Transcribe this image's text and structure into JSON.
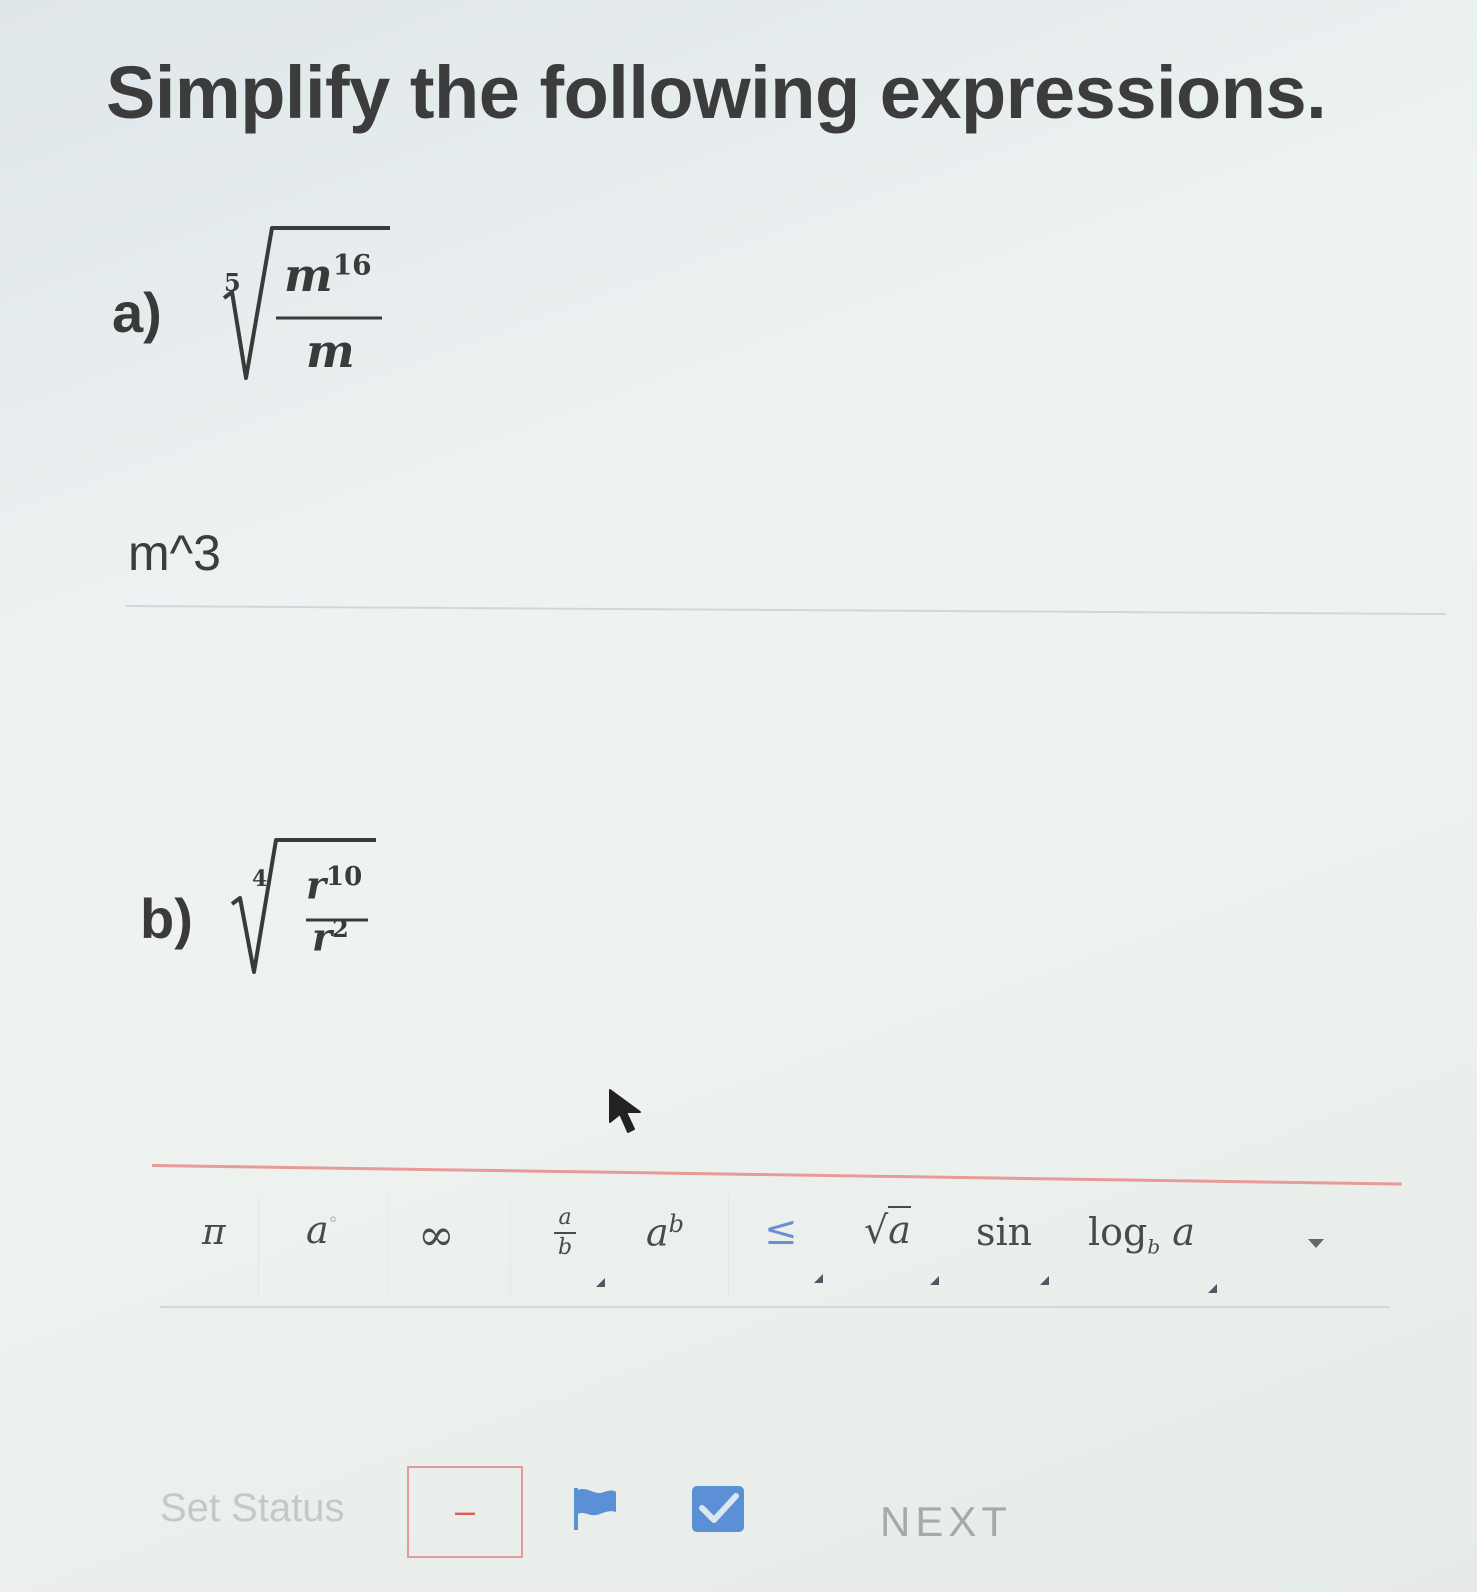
{
  "title": "Simplify the following expressions.",
  "questions": [
    {
      "label": "a)",
      "index": "5",
      "numerator_base": "m",
      "numerator_exp": "16",
      "denominator_base": "m",
      "denominator_exp": "",
      "answer": "m^3"
    },
    {
      "label": "b)",
      "index": "4",
      "numerator_base": "r",
      "numerator_exp": "10",
      "denominator_base": "r",
      "denominator_exp": "2",
      "answer": ""
    }
  ],
  "toolbar": {
    "pi": "π",
    "a_degree_base": "a",
    "a_degree_sup": "°",
    "infinity": "∞",
    "frac_num": "a",
    "frac_den": "b",
    "power_base": "a",
    "power_exp": "b",
    "leq": "≤",
    "sqrt_symbol": "√",
    "sqrt_arg": "a",
    "sin": "sin",
    "log": "log",
    "log_base": "b",
    "log_arg": "a"
  },
  "footer": {
    "set_status": "Set Status",
    "status_value": "–",
    "next": "NEXT"
  },
  "colors": {
    "input_underline": "#e89a9a",
    "flag_icon": "#5b8fd6",
    "check_icon": "#5b8fd6"
  }
}
